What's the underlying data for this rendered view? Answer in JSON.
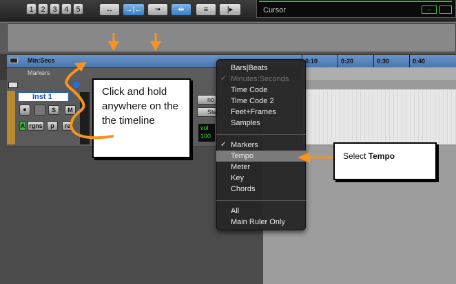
{
  "toolbar": {
    "number_buttons": [
      "1",
      "2",
      "3",
      "4",
      "5"
    ],
    "counter_label": "Cursor"
  },
  "ruler": {
    "main_ruler_label": "Min:Secs",
    "ticks": [
      "0:10",
      "0:20",
      "0:30",
      "0:40"
    ],
    "markers_label": "Markers"
  },
  "track": {
    "name": "Inst 1",
    "solo_label": "S",
    "mute_label": "M",
    "rgns_label": "rgns",
    "p_label": "p",
    "re_label": "re",
    "no_label": "no",
    "st_label": "Ste",
    "vol_label": "vol",
    "vol_value": "100"
  },
  "menu": {
    "group1": [
      {
        "label": "Bars|Beats",
        "checked": false,
        "disabled": false
      },
      {
        "label": "Minutes:Seconds",
        "checked": true,
        "disabled": true
      },
      {
        "label": "Time Code",
        "checked": false,
        "disabled": false
      },
      {
        "label": "Time Code 2",
        "checked": false,
        "disabled": false
      },
      {
        "label": "Feet+Frames",
        "checked": false,
        "disabled": false
      },
      {
        "label": "Samples",
        "checked": false,
        "disabled": false
      }
    ],
    "group2": [
      {
        "label": "Markers",
        "checked": true,
        "disabled": false
      },
      {
        "label": "Tempo",
        "checked": false,
        "disabled": false,
        "highlighted": true
      },
      {
        "label": "Meter",
        "checked": false,
        "disabled": false
      },
      {
        "label": "Key",
        "checked": false,
        "disabled": false
      },
      {
        "label": "Chords",
        "checked": false,
        "disabled": false
      }
    ],
    "group3": [
      {
        "label": "All",
        "checked": false,
        "disabled": false
      },
      {
        "label": "Main Ruler Only",
        "checked": false,
        "disabled": false
      }
    ],
    "check_glyph": "✓"
  },
  "callouts": {
    "left_text": "Click and hold anywhere on the the timeline",
    "right_prefix": "Select ",
    "right_bold": "Tempo"
  },
  "colors": {
    "annotation_arrow": "#f7931e",
    "ruler_blue": "#5a86bd",
    "menu_highlight": "#7a7a7a"
  }
}
